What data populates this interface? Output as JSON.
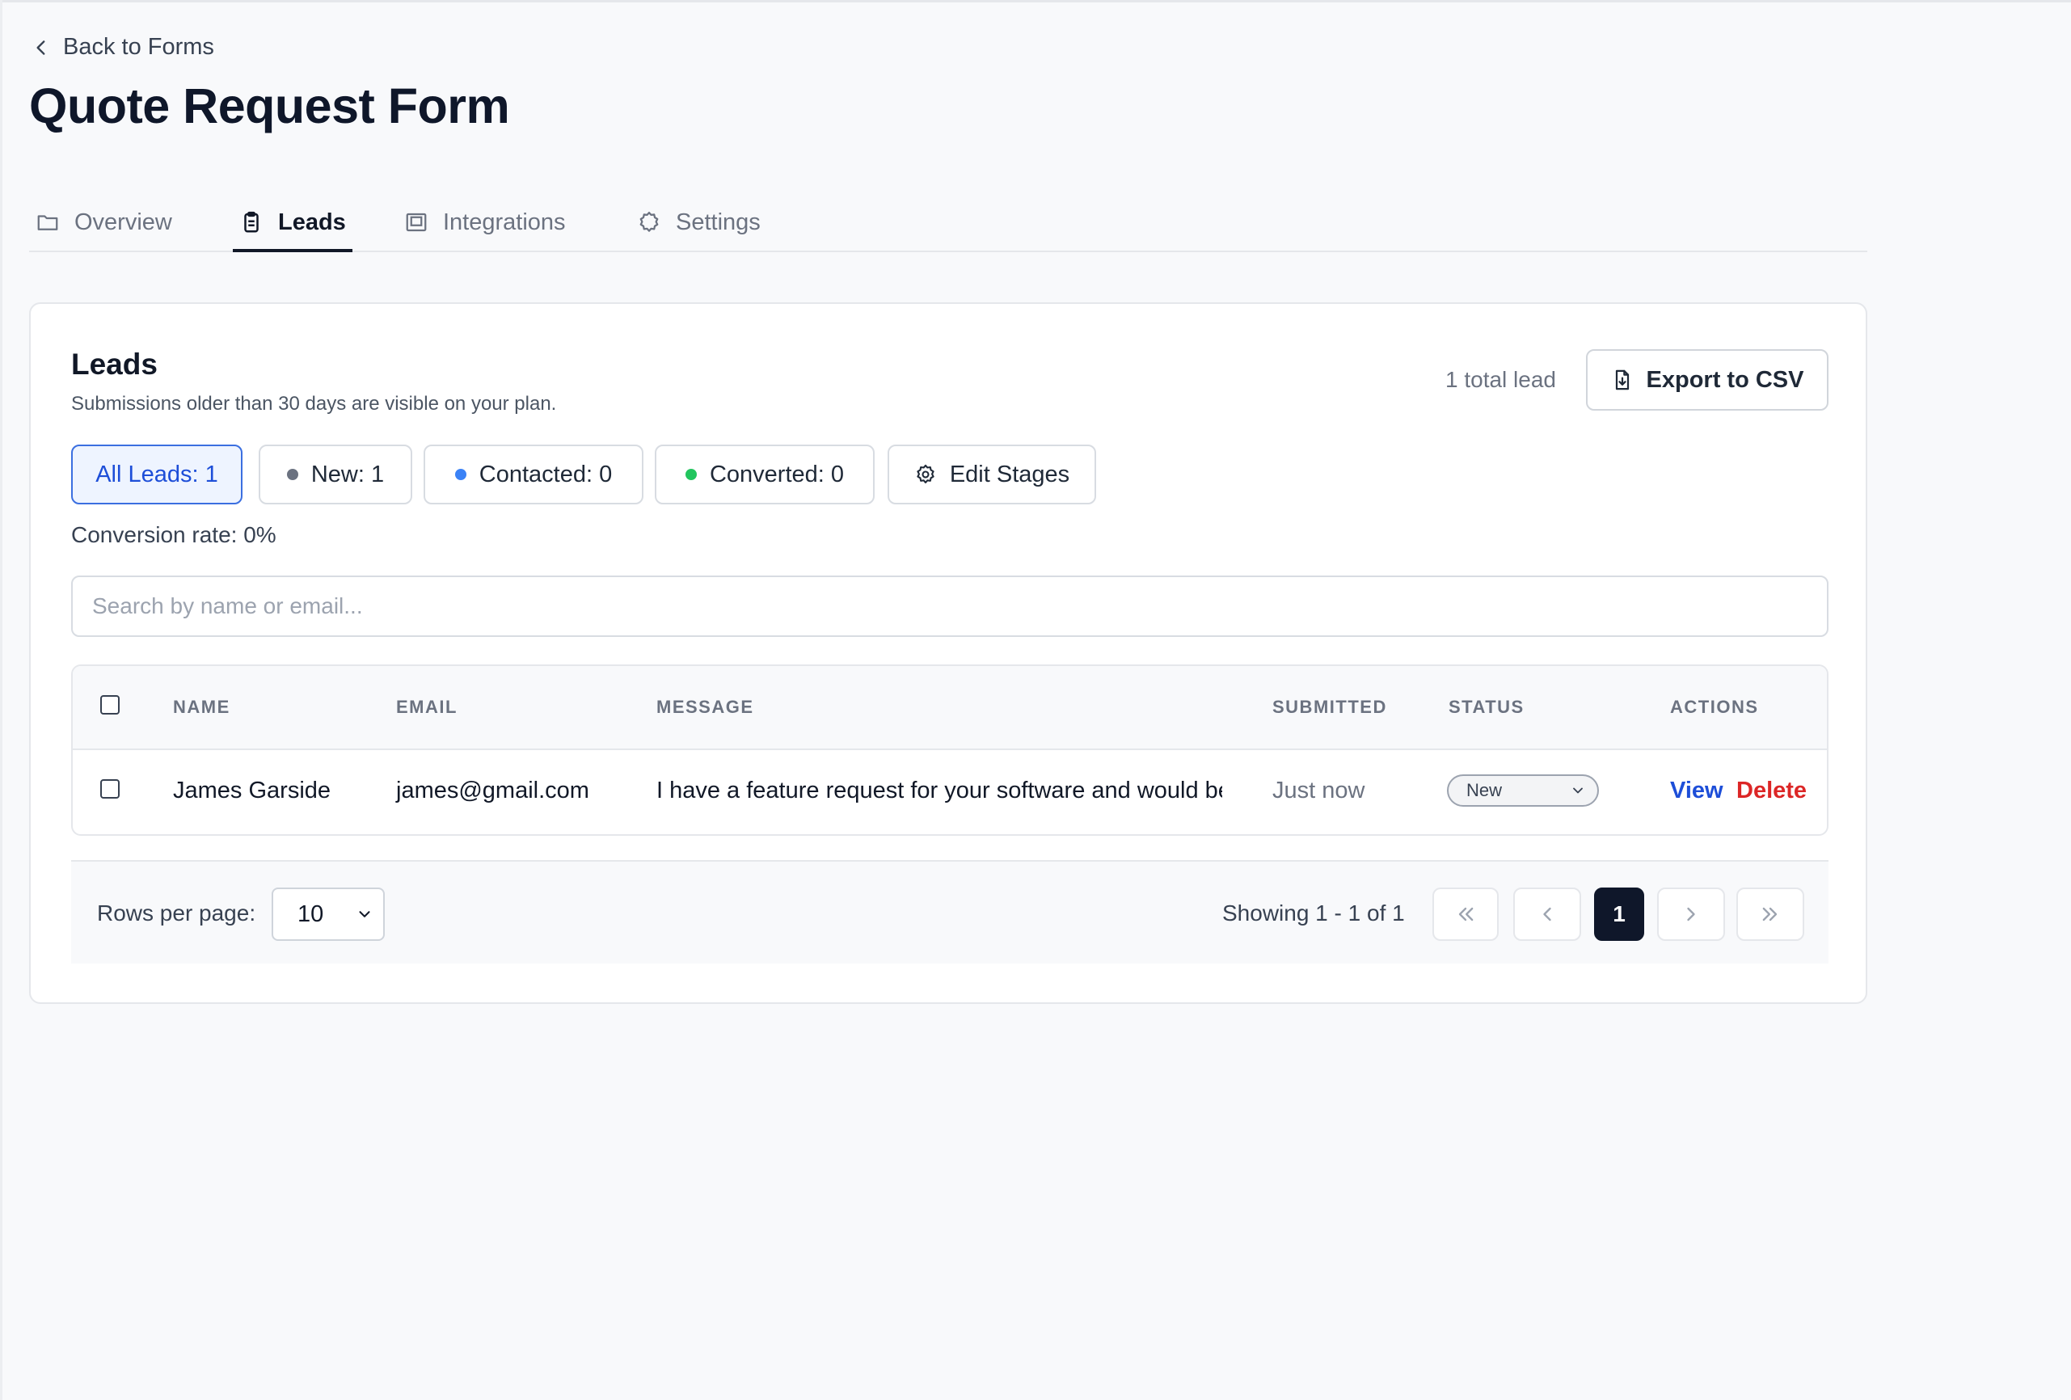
{
  "nav": {
    "back_label": "Back to Forms"
  },
  "page": {
    "title": "Quote Request Form"
  },
  "tabs": [
    {
      "label": "Overview",
      "icon": "folder-icon",
      "active": false
    },
    {
      "label": "Leads",
      "icon": "clipboard-icon",
      "active": true
    },
    {
      "label": "Integrations",
      "icon": "layout-icon",
      "active": false
    },
    {
      "label": "Settings",
      "icon": "settings-icon",
      "active": false
    }
  ],
  "leads": {
    "title": "Leads",
    "subtitle": "Submissions older than 30 days are visible on your plan.",
    "total": "1 total lead",
    "export_label": "Export to CSV",
    "filters": [
      {
        "label": "All Leads: 1",
        "active": true
      },
      {
        "label": "New: 1",
        "dot_color": "#6b7280"
      },
      {
        "label": "Contacted: 0",
        "dot_color": "#3b82f6"
      },
      {
        "label": "Converted: 0",
        "dot_color": "#22c55e"
      }
    ],
    "edit_stages_label": "Edit Stages",
    "conversion_rate": "Conversion rate: 0%",
    "search_placeholder": "Search by name or email...",
    "search_value": ""
  },
  "table": {
    "columns": [
      "NAME",
      "EMAIL",
      "MESSAGE",
      "SUBMITTED",
      "STATUS",
      "ACTIONS"
    ],
    "rows": [
      {
        "name": "James Garside",
        "email": "james@gmail.com",
        "message": "I have a feature request for your software and would be",
        "submitted": "Just now",
        "status": "New",
        "view_label": "View",
        "delete_label": "Delete"
      }
    ]
  },
  "pagination": {
    "rows_per_page_label": "Rows per page:",
    "rows_per_page": "10",
    "showing": "Showing 1 - 1 of 1",
    "current_page": "1"
  },
  "colors": {
    "accent_blue": "#1d4ed8",
    "danger_red": "#dc2626",
    "dark": "#0f172a"
  }
}
